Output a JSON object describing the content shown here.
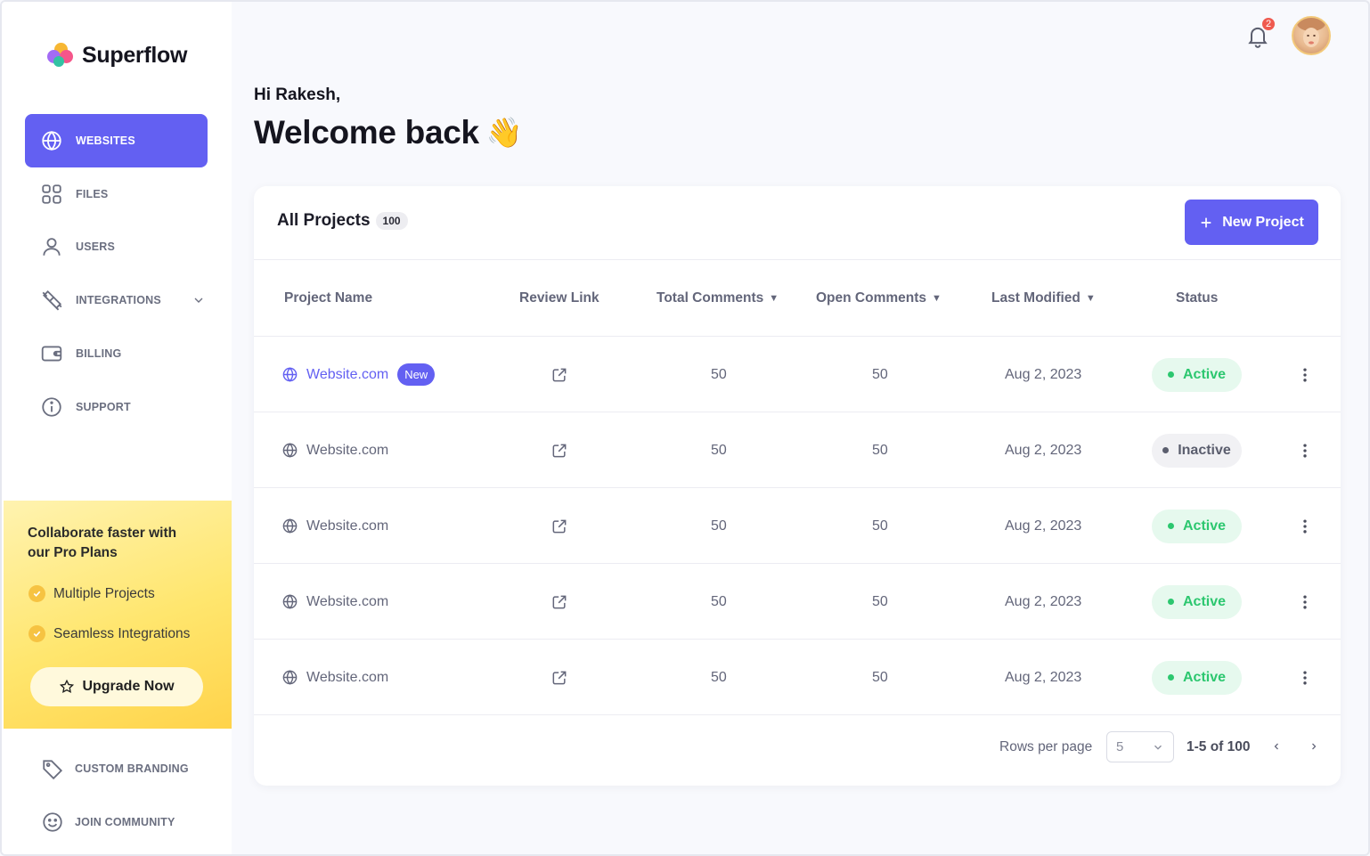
{
  "app": {
    "name": "Superflow"
  },
  "sidebar": {
    "items": [
      {
        "label": "WEBSITES",
        "icon": "globe-icon",
        "active": true
      },
      {
        "label": "FILES",
        "icon": "grid-icon"
      },
      {
        "label": "USERS",
        "icon": "user-icon"
      },
      {
        "label": "INTEGRATIONS",
        "icon": "plug-icon",
        "expandable": true
      },
      {
        "label": "BILLING",
        "icon": "wallet-icon"
      },
      {
        "label": "SUPPORT",
        "icon": "info-icon"
      }
    ],
    "promo": {
      "title_line1": "Collaborate faster with",
      "title_line2": "our Pro Plans",
      "features": [
        "Multiple Projects",
        "Seamless Integrations"
      ],
      "button": "Upgrade Now"
    },
    "footer": [
      {
        "label": "CUSTOM BRANDING",
        "icon": "tag-icon"
      },
      {
        "label": "JOIN COMMUNITY",
        "icon": "smile-icon"
      }
    ]
  },
  "topbar": {
    "notifications": "2"
  },
  "header": {
    "greeting": "Hi Rakesh,",
    "title": "Welcome back",
    "emoji": "👋"
  },
  "projects": {
    "title": "All Projects",
    "count": "100",
    "new_button": "New Project",
    "columns": [
      "Project Name",
      "Review Link",
      "Total Comments",
      "Open Comments",
      "Last Modified",
      "Status"
    ],
    "rows": [
      {
        "name": "Website.com",
        "badge": "New",
        "total": "50",
        "open": "50",
        "modified": "Aug 2, 2023",
        "status": "Active"
      },
      {
        "name": "Website.com",
        "total": "50",
        "open": "50",
        "modified": "Aug 2, 2023",
        "status": "Inactive"
      },
      {
        "name": "Website.com",
        "total": "50",
        "open": "50",
        "modified": "Aug 2, 2023",
        "status": "Active"
      },
      {
        "name": "Website.com",
        "total": "50",
        "open": "50",
        "modified": "Aug 2, 2023",
        "status": "Active"
      },
      {
        "name": "Website.com",
        "total": "50",
        "open": "50",
        "modified": "Aug 2, 2023",
        "status": "Active"
      }
    ],
    "pagination": {
      "rows_label": "Rows per page",
      "rows_value": "5",
      "range": "1-5 of 100"
    }
  },
  "colors": {
    "accent": "#6360f2",
    "active": "#2cc76f",
    "promo": "#ffe66e",
    "badge": "#ef5a4f"
  }
}
